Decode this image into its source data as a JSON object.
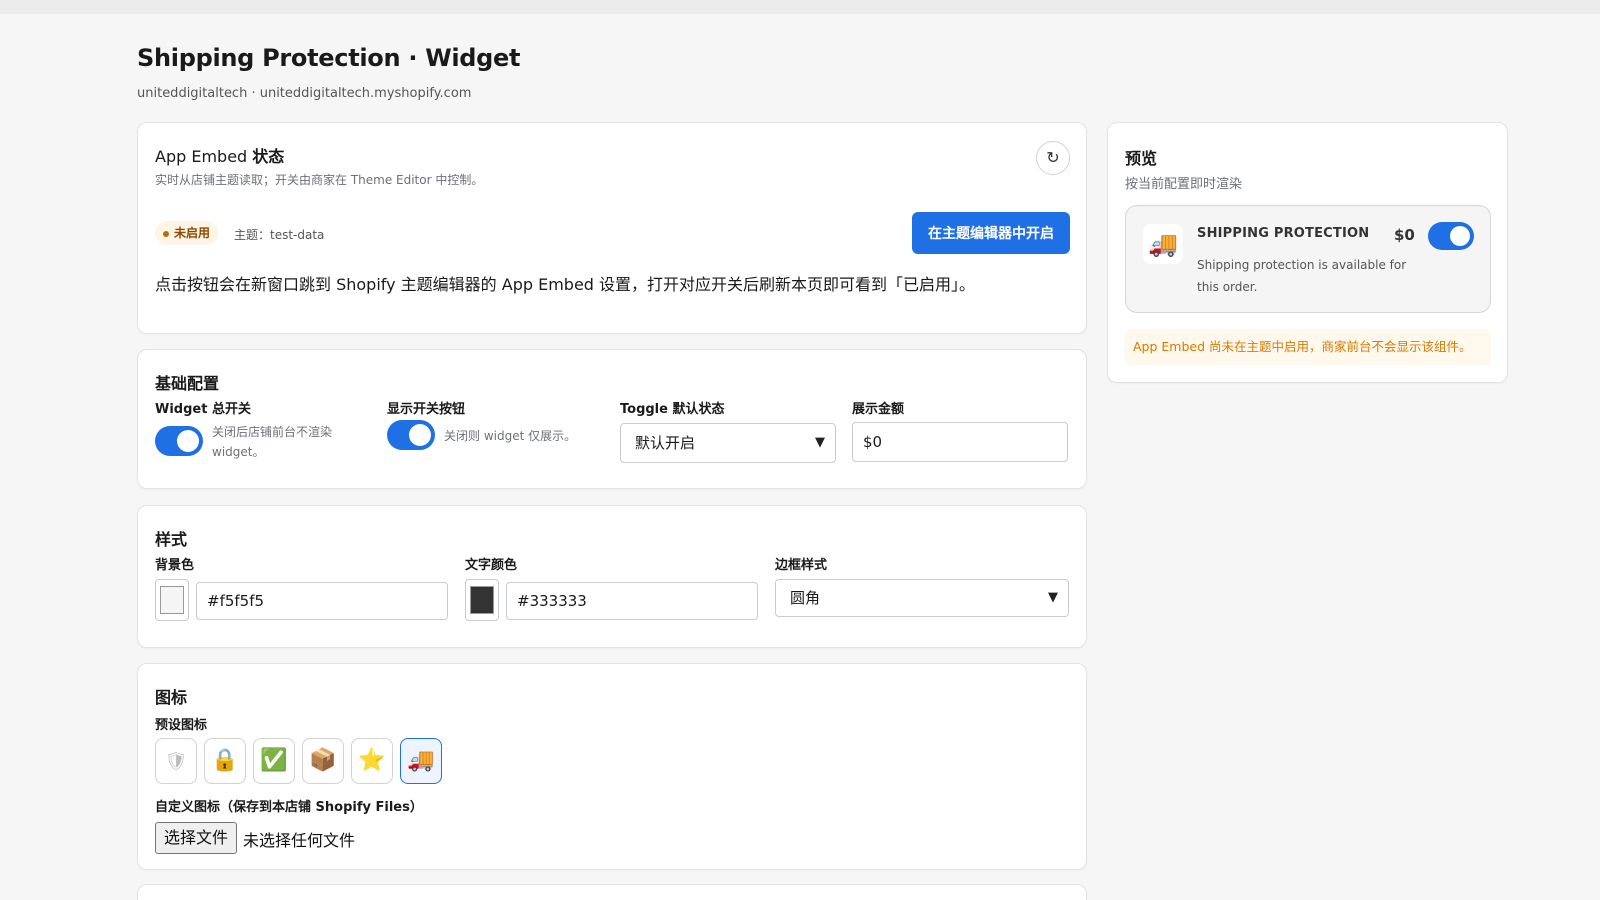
{
  "header": {
    "title": "Shipping Protection · Widget",
    "subtitle": "uniteddigitaltech · uniteddigitaltech.myshopify.com"
  },
  "embed": {
    "title_prefix": "App Embed ",
    "title_suffix": "状态",
    "description": "实时从店铺主题读取；开关由商家在 Theme Editor 中控制。",
    "refresh_icon": "↻",
    "status_badge": "未启用",
    "theme_label": "主题：test-data",
    "open_button": "在主题编辑器中开启",
    "note": "点击按钮会在新窗口跳到 Shopify 主题编辑器的 App Embed 设置，打开对应开关后刷新本页即可看到「已启用」。"
  },
  "basic": {
    "title": "基础配置",
    "widget_switch_label": "Widget 总开关",
    "widget_switch_on": true,
    "widget_switch_help": "关闭后店铺前台不渲染 widget。",
    "show_toggle_label": "显示开关按钮",
    "show_toggle_on": true,
    "show_toggle_help": "关闭则 widget 仅展示。",
    "toggle_default_label": "Toggle 默认状态",
    "toggle_default_value": "默认开启",
    "amount_label": "展示金额",
    "amount_value": "$0"
  },
  "style": {
    "title": "样式",
    "bg_label": "背景色",
    "bg_value": "#f5f5f5",
    "text_label": "文字颜色",
    "text_value": "#333333",
    "border_label": "边框样式",
    "border_value": "圆角"
  },
  "icons": {
    "title": "图标",
    "preset_label": "预设图标",
    "presets": [
      {
        "name": "shield",
        "glyph": "🛡"
      },
      {
        "name": "lock",
        "glyph": "🔒"
      },
      {
        "name": "check",
        "glyph": "✅"
      },
      {
        "name": "package",
        "glyph": "📦"
      },
      {
        "name": "star",
        "glyph": "⭐"
      },
      {
        "name": "truck",
        "glyph": "🚚"
      }
    ],
    "selected": "truck",
    "custom_label": "自定义图标（保存到本店铺 Shopify Files）",
    "file_button": "选择文件",
    "file_status": "未选择任何文件"
  },
  "preview": {
    "title": "预览",
    "subtitle": "按当前配置即时渲染",
    "widget_icon": "🚚",
    "widget_title": "SHIPPING PROTECTION",
    "widget_price": "$0",
    "widget_desc": "Shipping protection is available for this order.",
    "widget_toggle_on": true,
    "warning": "App Embed 尚未在主题中启用，商家前台不会显示该组件。"
  },
  "colors": {
    "accent": "#1f6fe5",
    "warning_bg": "#fff8ec",
    "warning_text": "#d97a00",
    "badge_bg": "#fff4e5"
  }
}
